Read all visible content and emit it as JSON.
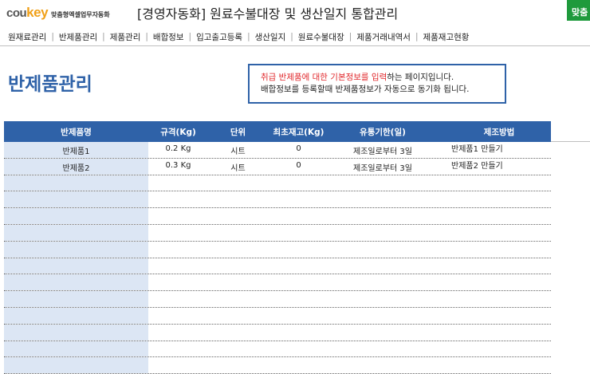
{
  "header": {
    "logo_cou": "cou",
    "logo_key": "key",
    "logo_tagline": "맞춤형엑셀업무자동화",
    "app_title": "[경영자동화] 원료수불대장 및 생산일지 통합관리",
    "green_button": "맞춤"
  },
  "nav": [
    "원재료관리",
    "반제품관리",
    "제품관리",
    "배합정보",
    "입고출고등록",
    "생산일지",
    "원료수불대장",
    "제품거래내역서",
    "제품재고현황"
  ],
  "page_title": "반제품관리",
  "notice": {
    "line1_red": "취급 반제품에 대한 기본정보를 입력",
    "line1_rest": "하는 페이지입니다.",
    "line2": "배합정보를 등록할때 반제품정보가 자동으로 동기화 됩니다."
  },
  "table": {
    "columns": [
      "반제품명",
      "규격(Kg)",
      "단위",
      "최초재고(Kg)",
      "유통기한(일)",
      "제조방법"
    ],
    "rows": [
      [
        "반제품1",
        "0.2 Kg",
        "시트",
        "0",
        "제조일로부터 3일",
        "반제품1 만들기"
      ],
      [
        "반제품2",
        "0.3 Kg",
        "시트",
        "0",
        "제조일로부터 3일",
        "반제품2 만들기"
      ]
    ]
  },
  "colors": {
    "accent": "#2f62a8",
    "first_col_fill": "#dce6f4",
    "notice_red": "#e0262a",
    "button_green": "#1f9a3c",
    "logo_orange": "#f0a018"
  }
}
